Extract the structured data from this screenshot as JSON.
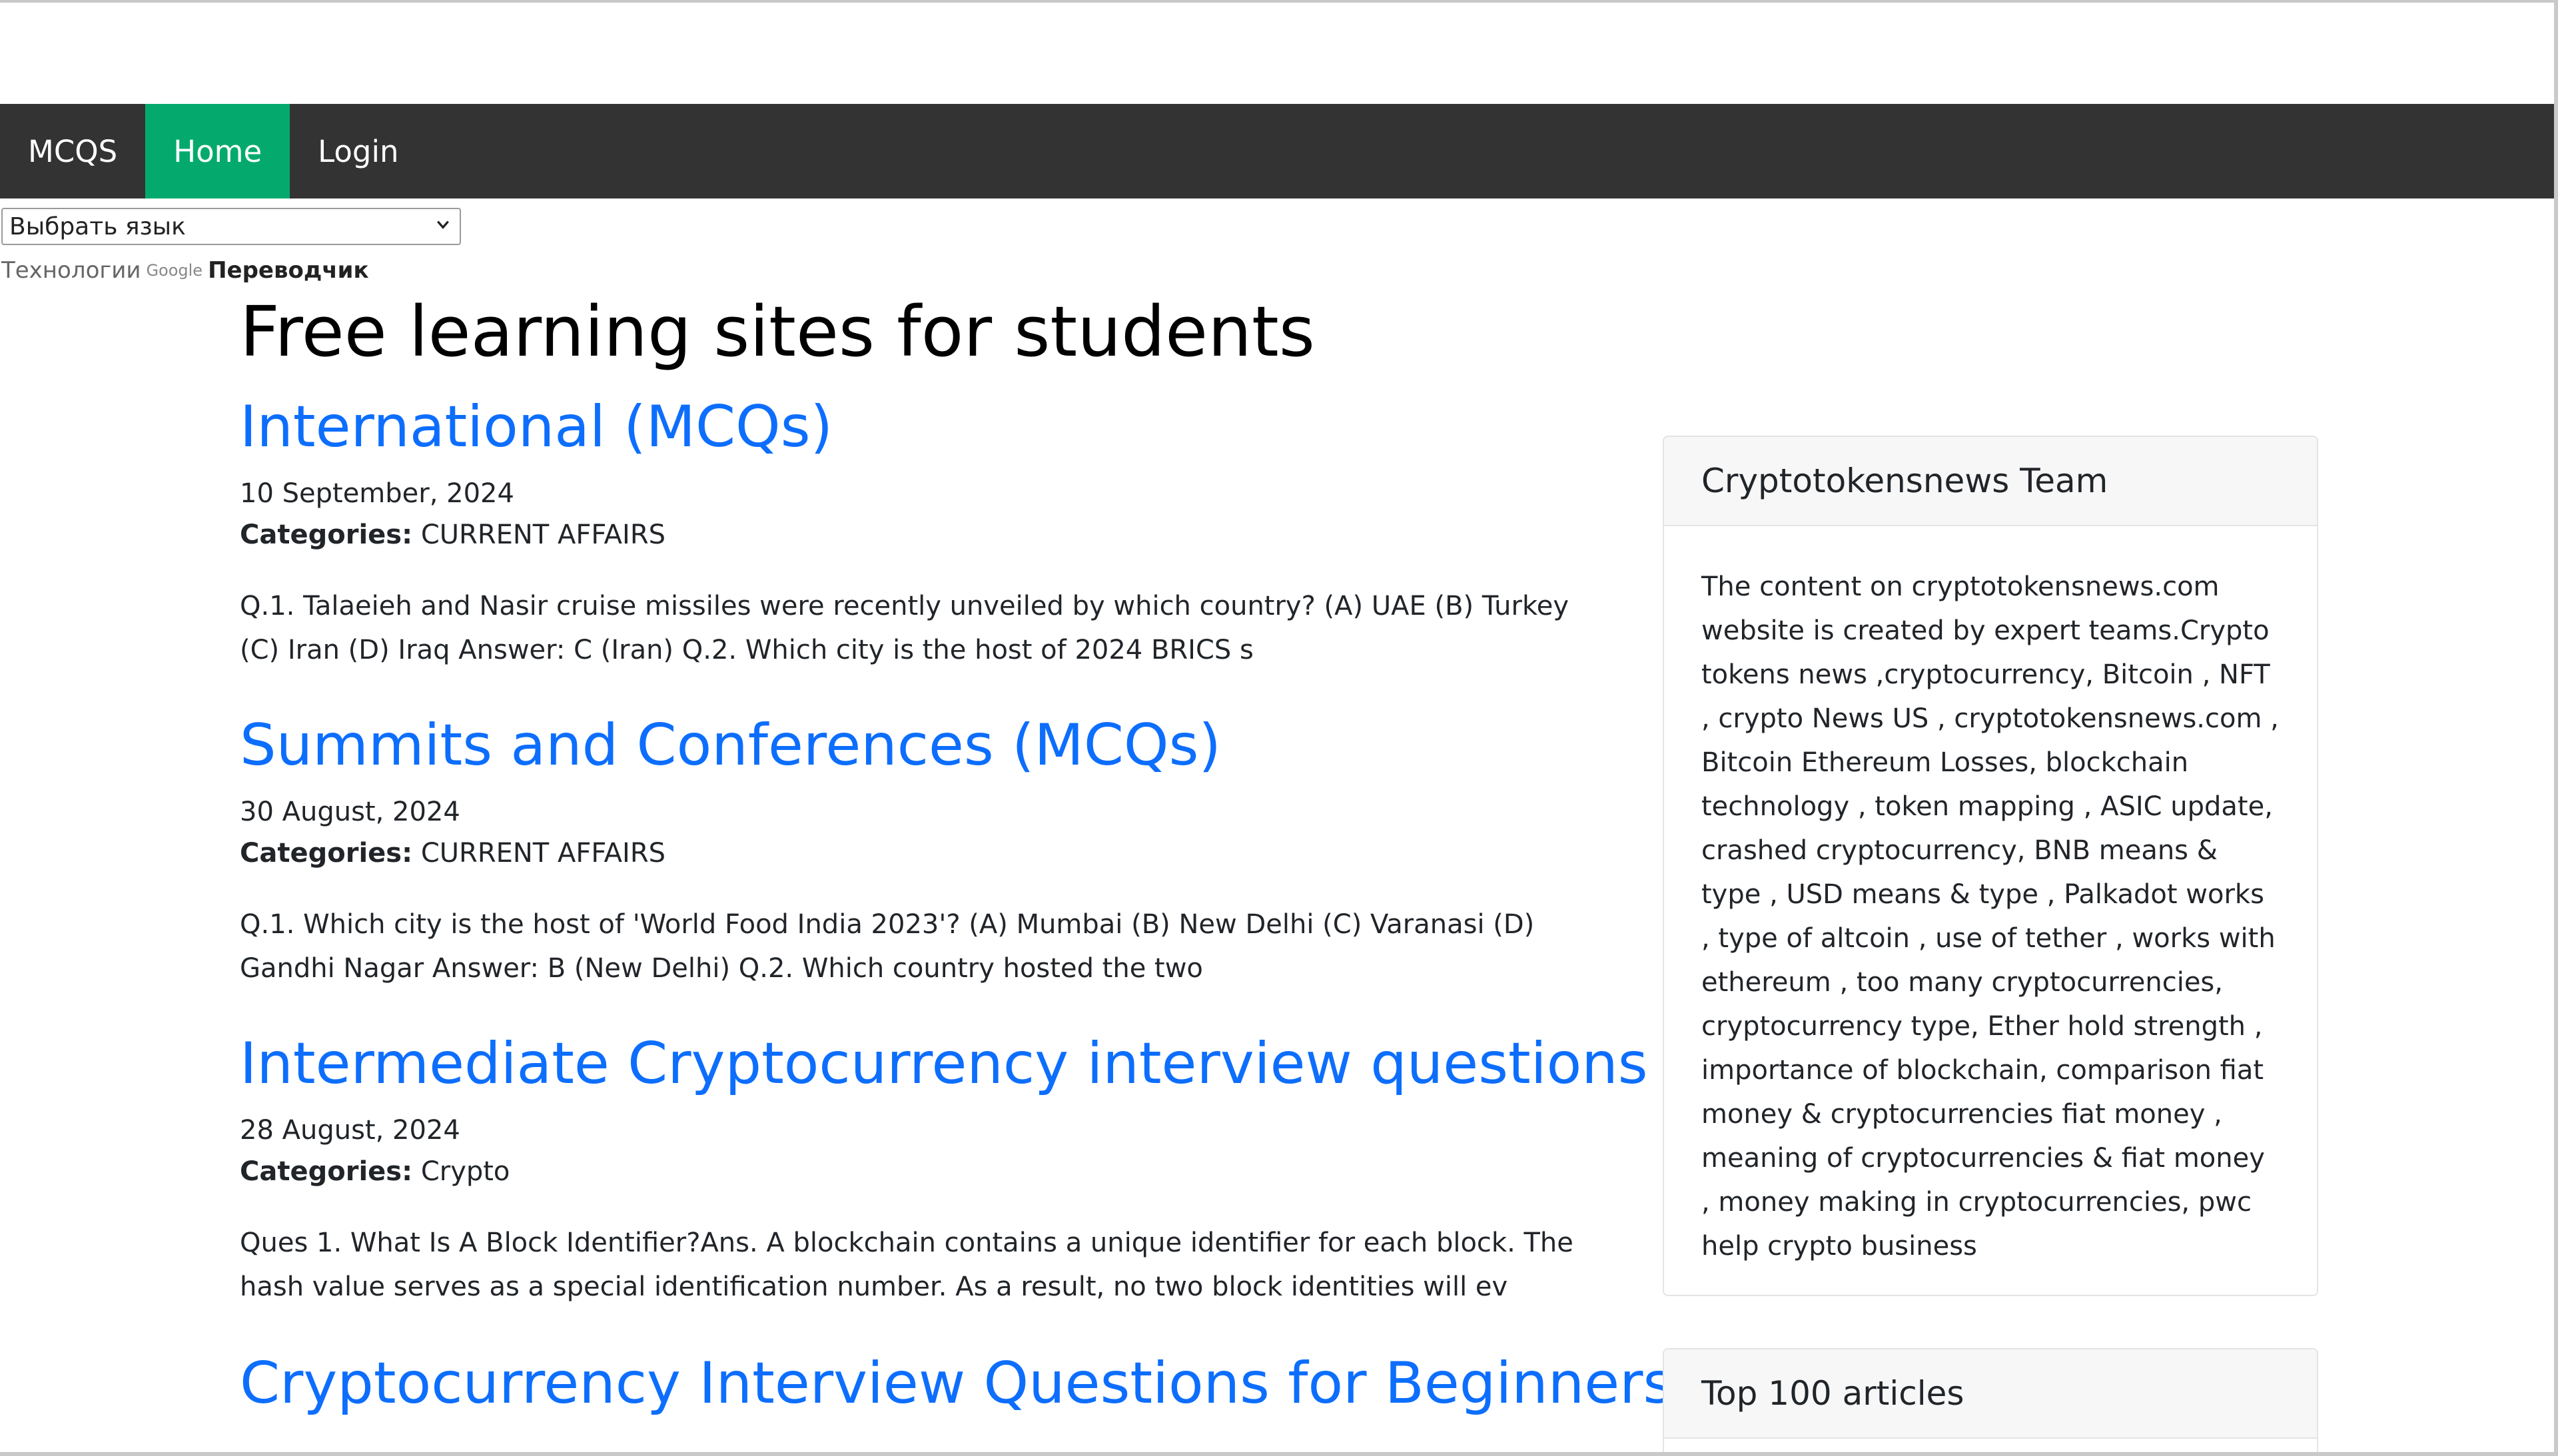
{
  "navbar": {
    "items": [
      {
        "label": "MCQS",
        "active": false
      },
      {
        "label": "Home",
        "active": true
      },
      {
        "label": "Login",
        "active": false
      }
    ],
    "background": "#333333",
    "active_color": "#04aa6d"
  },
  "translate": {
    "select_label": "Выбрать язык",
    "powered_prefix": "Технологии",
    "google": "Google",
    "translator": "Переводчик"
  },
  "page": {
    "title": "Free learning sites for students"
  },
  "posts": [
    {
      "title": "International (MCQs)",
      "date": "10 September, 2024",
      "categories_label": "Categories:",
      "category": "CURRENT AFFAIRS",
      "excerpt": "Q.1. Talaeieh and Nasir cruise missiles were recently unveiled by which country? (A) UAE (B) Turkey (C) Iran (D) Iraq   Answer: C (Iran)   Q.2. Which city is the host of 2024 BRICS s"
    },
    {
      "title": "Summits and Conferences (MCQs)",
      "date": "30 August, 2024",
      "categories_label": "Categories:",
      "category": "CURRENT AFFAIRS",
      "excerpt": "Q.1. Which city is the host of 'World Food India 2023'? (A) Mumbai (B) New Delhi (C) Varanasi (D) Gandhi Nagar   Answer: B (New Delhi)   Q.2. Which country hosted the two"
    },
    {
      "title": "Intermediate Cryptocurrency interview questions",
      "date": "28 August, 2024",
      "categories_label": "Categories:",
      "category": "Crypto",
      "excerpt": "Ques 1. What Is A Block Identifier?Ans. A blockchain contains a unique identifier for each block. The hash value serves as a special identification number. As a result, no two block identities will ev"
    },
    {
      "title": "Cryptocurrency Interview Questions for Beginners",
      "date": "",
      "categories_label": "",
      "category": "",
      "excerpt": ""
    }
  ],
  "sidebar": {
    "team_card": {
      "title": "Cryptotokensnews Team",
      "body": "The content on cryptotokensnews.com website is created by expert teams.Crypto tokens news ,cryptocurrency, Bitcoin , NFT , crypto News US , cryptotokensnews.com , Bitcoin Ethereum Losses, blockchain technology , token mapping , ASIC update, crashed cryptocurrency, BNB means & type , USD means & type , Palkadot works , type of altcoin , use of tether , works with ethereum , too many cryptocurrencies, cryptocurrency type, Ether hold strength , importance of blockchain, comparison fiat money & cryptocurrencies fiat money , meaning of cryptocurrencies & fiat money , money making in cryptocurrencies, pwc help crypto business"
    },
    "top_card": {
      "title": "Top 100 articles"
    }
  },
  "colors": {
    "link": "#0d6efd",
    "text": "#212529"
  }
}
